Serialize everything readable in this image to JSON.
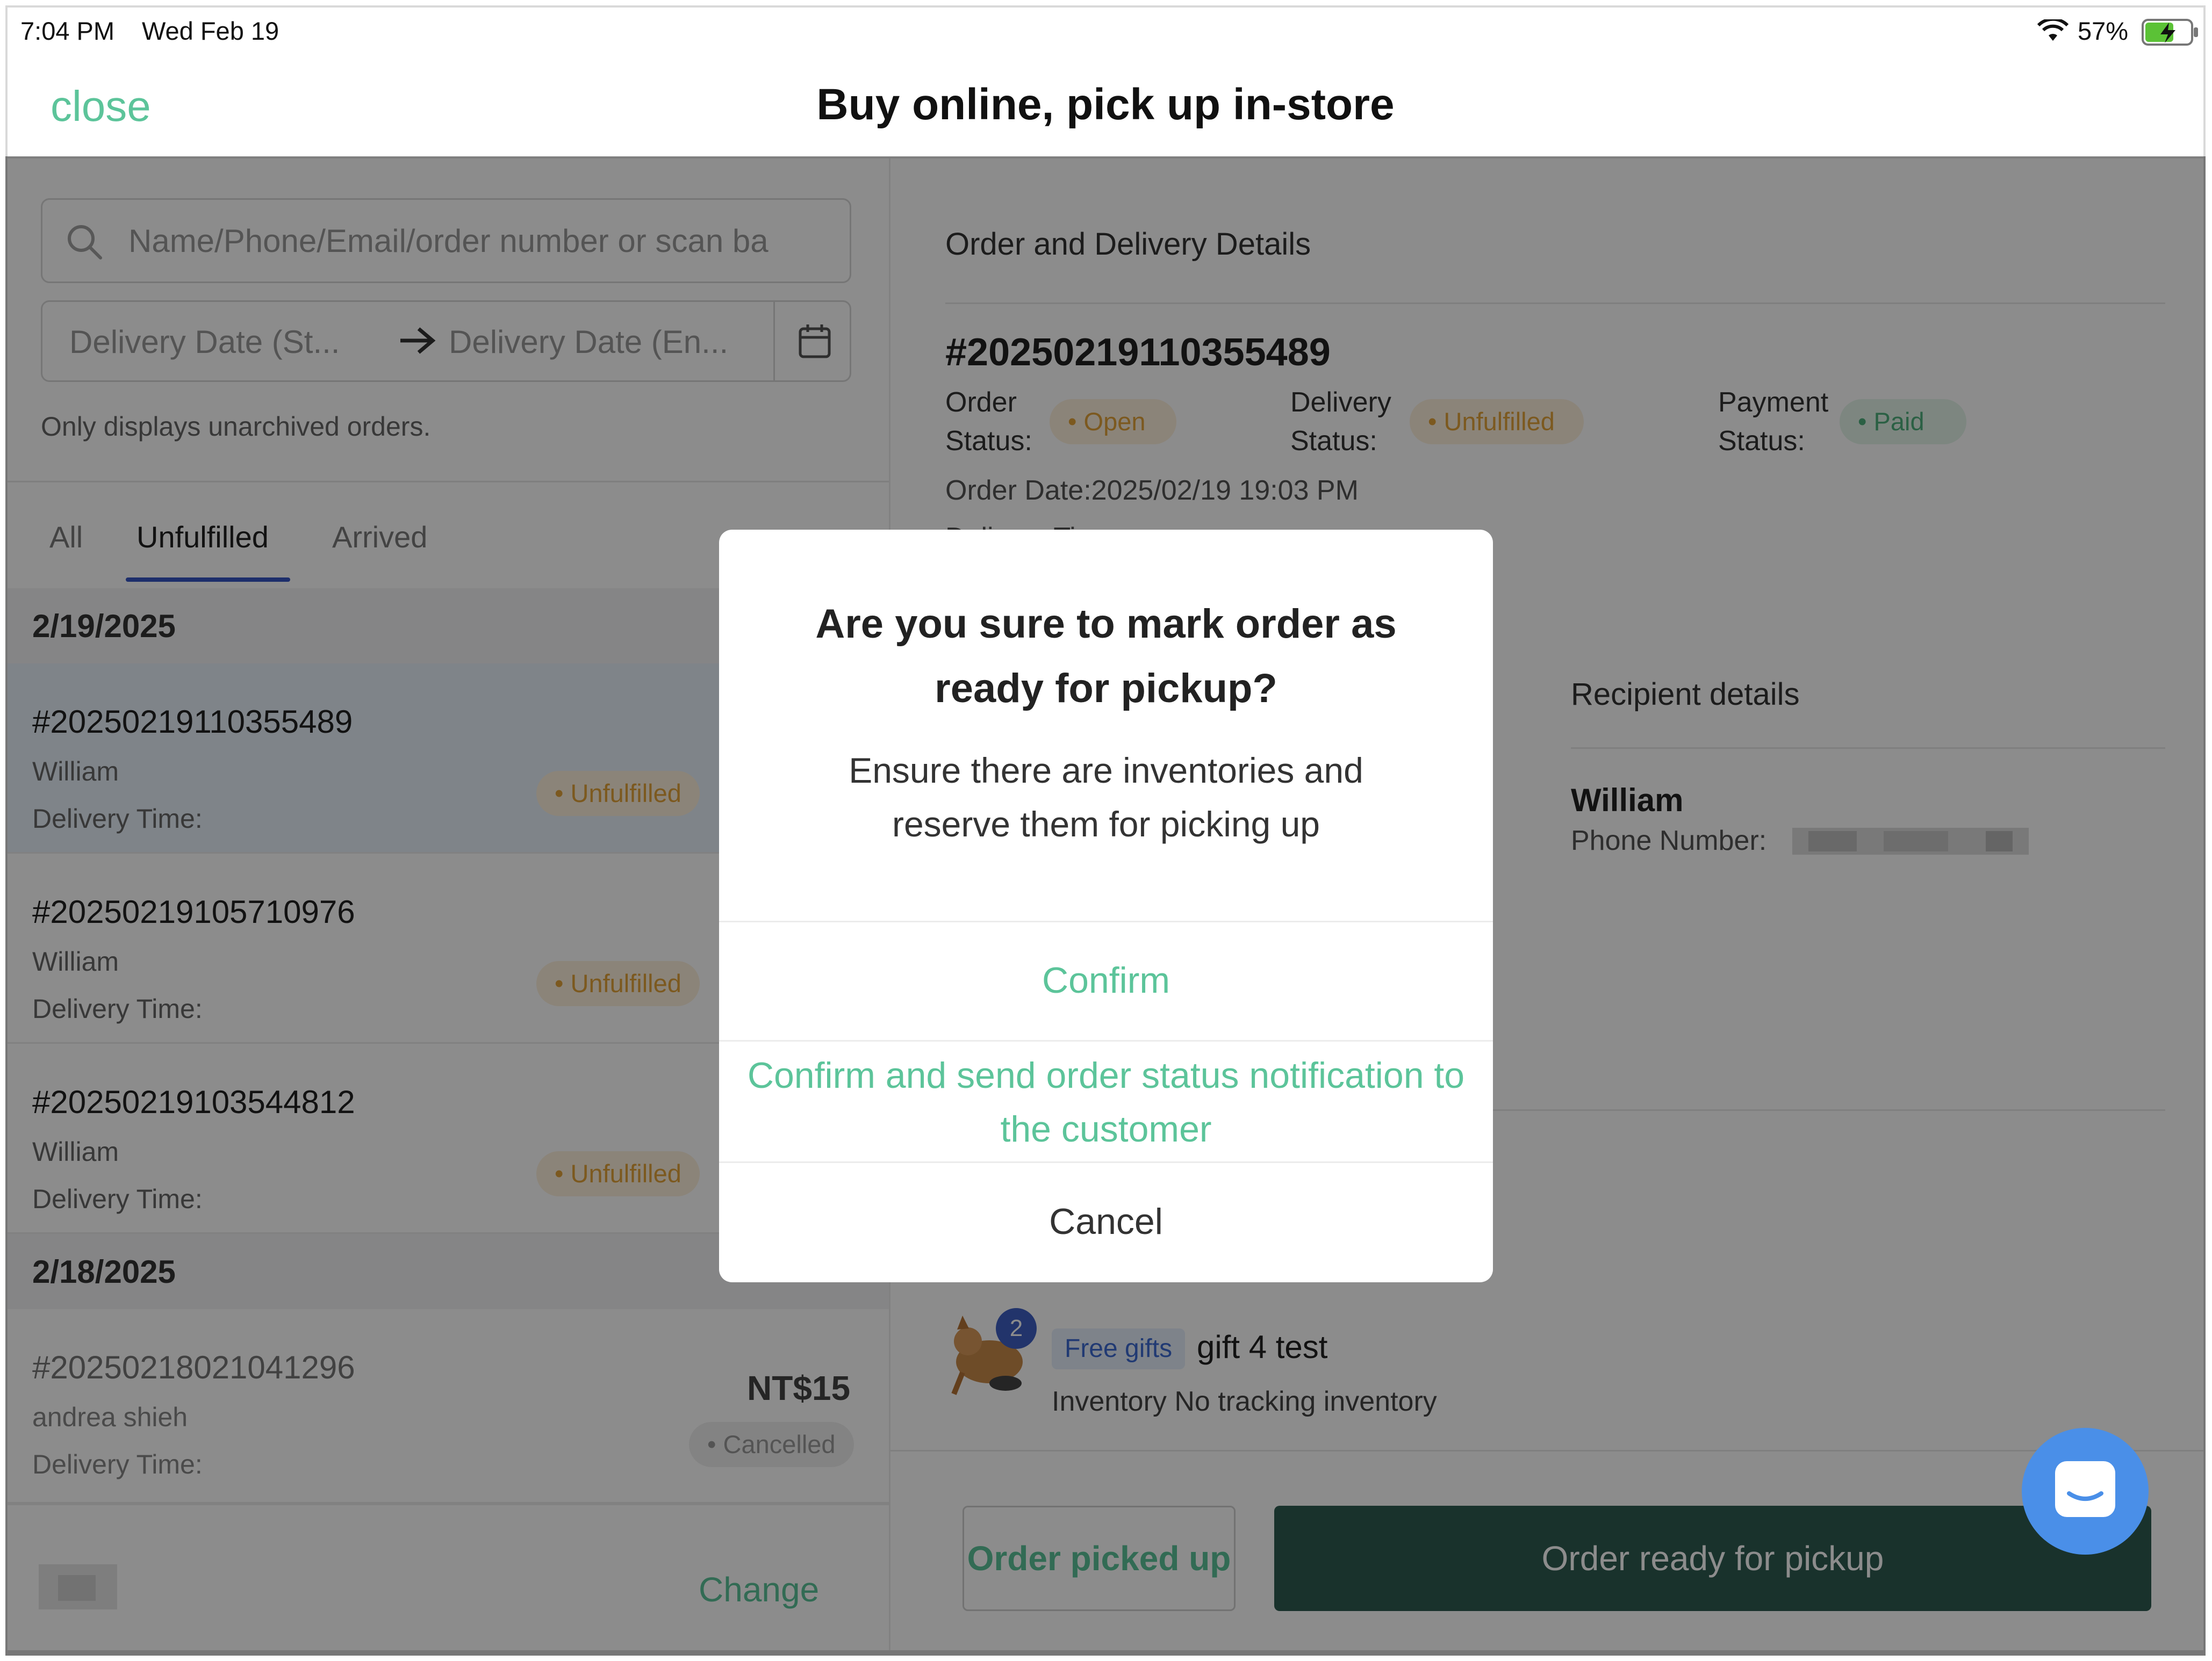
{
  "status_bar": {
    "time": "7:04 PM",
    "date": "Wed Feb 19",
    "battery": "57%"
  },
  "header": {
    "close_label": "close",
    "title": "Buy online, pick up in-store"
  },
  "search": {
    "placeholder": "Name/Phone/Email/order number or scan ba"
  },
  "date_range": {
    "start_placeholder": "Delivery Date (St...",
    "end_placeholder": "Delivery Date (En..."
  },
  "note": "Only displays unarchived orders.",
  "tabs": [
    {
      "label": "All"
    },
    {
      "label": "Unfulfilled",
      "active": true
    },
    {
      "label": "Arrived"
    }
  ],
  "groups": [
    {
      "date": "2/19/2025",
      "orders": [
        {
          "number": "#20250219110355489",
          "name": "William",
          "delivery": "Delivery Time:",
          "status": "Unfulfilled"
        },
        {
          "number": "#20250219105710976",
          "name": "William",
          "delivery": "Delivery Time:",
          "status": "Unfulfilled"
        },
        {
          "number": "#20250219103544812",
          "name": "William",
          "delivery": "Delivery Time:",
          "status": "Unfulfilled"
        }
      ]
    },
    {
      "date": "2/18/2025",
      "orders": [
        {
          "number": "#20250218021041296",
          "name": "andrea shieh",
          "delivery": "Delivery Time:",
          "status": "Cancelled",
          "amount": "NT$15"
        }
      ]
    }
  ],
  "left_footer": {
    "change_label": "Change"
  },
  "details": {
    "section_title": "Order and Delivery Details",
    "order_number": "#20250219110355489",
    "order_status_label_1": "Order",
    "order_status_label_2": "Status:",
    "order_status": "Open",
    "delivery_status_label_1": "Delivery",
    "delivery_status_label_2": "Status:",
    "delivery_status": "Unfulfilled",
    "payment_status_label_1": "Payment",
    "payment_status_label_2": "Status:",
    "payment_status": "Paid",
    "order_date": "Order Date:2025/02/19 19:03 PM",
    "delivery_time_partial": "Delivery Time:",
    "recipient_title": "Recipient details",
    "recipient_name": "William",
    "phone_label": "Phone Number:"
  },
  "item": {
    "badge_count": "2",
    "tag": "Free gifts",
    "name": "gift 4 test",
    "inventory": "Inventory No tracking inventory"
  },
  "actions": {
    "picked_up": "Order picked up",
    "ready": "Order ready for pickup"
  },
  "modal": {
    "title": "Are you sure to mark order as ready for pickup?",
    "message": "Ensure there are inventories and reserve them for picking up",
    "confirm": "Confirm",
    "confirm_notify": "Confirm and send order status notification to the customer",
    "cancel": "Cancel"
  },
  "colors": {
    "accent_green": "#5cc49a",
    "primary_button": "#2e5b50",
    "tab_underline": "#3554c4",
    "chat_button": "#4a8fe8"
  }
}
